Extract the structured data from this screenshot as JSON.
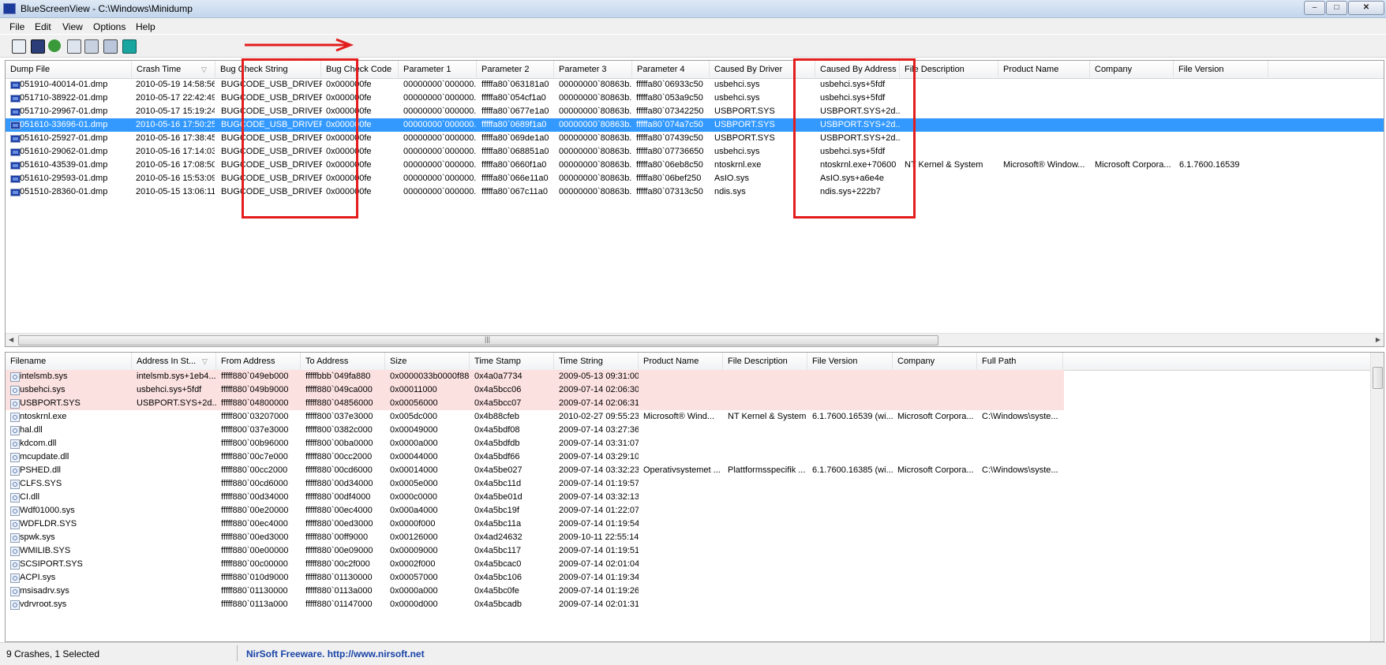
{
  "window": {
    "title": "BlueScreenView  -  C:\\Windows\\Minidump",
    "minimize": "–",
    "maximize": "□",
    "close": "✕"
  },
  "menu": [
    "File",
    "Edit",
    "View",
    "Options",
    "Help"
  ],
  "toolbar": [
    "save-html-report-icon",
    "save-icon",
    "refresh-icon",
    "copy-icon",
    "properties-icon",
    "advanced-options-icon",
    "exit-icon"
  ],
  "top_table": {
    "columns": [
      "Dump File",
      "Crash Time",
      "Bug Check String",
      "Bug Check Code",
      "Parameter 1",
      "Parameter 2",
      "Parameter 3",
      "Parameter 4",
      "Caused By Driver",
      "Caused By Address",
      "File Description",
      "Product Name",
      "Company",
      "File Version"
    ],
    "rows": [
      [
        "051910-40014-01.dmp",
        "2010-05-19 14:58:56",
        "BUGCODE_USB_DRIVER",
        "0x000000fe",
        "00000000`000000...",
        "fffffa80`063181a0",
        "00000000`80863b...",
        "fffffa80`06933c50",
        "usbehci.sys",
        "usbehci.sys+5fdf",
        "",
        "",
        "",
        ""
      ],
      [
        "051710-38922-01.dmp",
        "2010-05-17 22:42:49",
        "BUGCODE_USB_DRIVER",
        "0x000000fe",
        "00000000`000000...",
        "fffffa80`054cf1a0",
        "00000000`80863b...",
        "fffffa80`053a9c50",
        "usbehci.sys",
        "usbehci.sys+5fdf",
        "",
        "",
        "",
        ""
      ],
      [
        "051710-29967-01.dmp",
        "2010-05-17 15:19:24",
        "BUGCODE_USB_DRIVER",
        "0x000000fe",
        "00000000`000000...",
        "fffffa80`0677e1a0",
        "00000000`80863b...",
        "fffffa80`07342250",
        "USBPORT.SYS",
        "USBPORT.SYS+2d...",
        "",
        "",
        "",
        ""
      ],
      [
        "051610-33696-01.dmp",
        "2010-05-16 17:50:25",
        "BUGCODE_USB_DRIVER",
        "0x000000fe",
        "00000000`000000...",
        "fffffa80`0689f1a0",
        "00000000`80863b...",
        "fffffa80`074a7c50",
        "USBPORT.SYS",
        "USBPORT.SYS+2d...",
        "",
        "",
        "",
        ""
      ],
      [
        "051610-25927-01.dmp",
        "2010-05-16 17:38:45",
        "BUGCODE_USB_DRIVER",
        "0x000000fe",
        "00000000`000000...",
        "fffffa80`069de1a0",
        "00000000`80863b...",
        "fffffa80`07439c50",
        "USBPORT.SYS",
        "USBPORT.SYS+2d...",
        "",
        "",
        "",
        ""
      ],
      [
        "051610-29062-01.dmp",
        "2010-05-16 17:14:03",
        "BUGCODE_USB_DRIVER",
        "0x000000fe",
        "00000000`000000...",
        "fffffa80`068851a0",
        "00000000`80863b...",
        "fffffa80`07736650",
        "usbehci.sys",
        "usbehci.sys+5fdf",
        "",
        "",
        "",
        ""
      ],
      [
        "051610-43539-01.dmp",
        "2010-05-16 17:08:50",
        "BUGCODE_USB_DRIVER",
        "0x000000fe",
        "00000000`000000...",
        "fffffa80`0660f1a0",
        "00000000`80863b...",
        "fffffa80`06eb8c50",
        "ntoskrnl.exe",
        "ntoskrnl.exe+70600",
        "NT Kernel & System",
        "Microsoft® Window...",
        "Microsoft Corpora...",
        "6.1.7600.16539"
      ],
      [
        "051610-29593-01.dmp",
        "2010-05-16 15:53:09",
        "BUGCODE_USB_DRIVER",
        "0x000000fe",
        "00000000`000000...",
        "fffffa80`066e11a0",
        "00000000`80863b...",
        "fffffa80`06bef250",
        "AsIO.sys",
        "AsIO.sys+a6e4e",
        "",
        "",
        "",
        ""
      ],
      [
        "051510-28360-01.dmp",
        "2010-05-15 13:06:11",
        "BUGCODE_USB_DRIVER",
        "0x000000fe",
        "00000000`000000...",
        "fffffa80`067c11a0",
        "00000000`80863b...",
        "fffffa80`07313c50",
        "ndis.sys",
        "ndis.sys+222b7",
        "",
        "",
        "",
        ""
      ]
    ],
    "selected_index": 3,
    "scroll_grip": "|||",
    "scroll_left": "◀",
    "scroll_right": "▶"
  },
  "bottom_table": {
    "columns": [
      "Filename",
      "Address In St...",
      "From Address",
      "To Address",
      "Size",
      "Time Stamp",
      "Time String",
      "Product Name",
      "File Description",
      "File Version",
      "Company",
      "Full Path"
    ],
    "rows": [
      [
        "intelsmb.sys",
        "intelsmb.sys+1eb4...",
        "fffff880`049eb000",
        "fffffbbb`049fa880",
        "0x0000033b0000f880",
        "0x4a0a7734",
        "2009-05-13 09:31:00",
        "",
        "",
        "",
        "",
        ""
      ],
      [
        "usbehci.sys",
        "usbehci.sys+5fdf",
        "fffff880`049b9000",
        "fffff880`049ca000",
        "0x00011000",
        "0x4a5bcc06",
        "2009-07-14 02:06:30",
        "",
        "",
        "",
        "",
        ""
      ],
      [
        "USBPORT.SYS",
        "USBPORT.SYS+2d...",
        "fffff880`04800000",
        "fffff880`04856000",
        "0x00056000",
        "0x4a5bcc07",
        "2009-07-14 02:06:31",
        "",
        "",
        "",
        "",
        ""
      ],
      [
        "ntoskrnl.exe",
        "",
        "fffff800`03207000",
        "fffff800`037e3000",
        "0x005dc000",
        "0x4b88cfeb",
        "2010-02-27 09:55:23",
        "Microsoft® Wind...",
        "NT Kernel & System",
        "6.1.7600.16539 (wi...",
        "Microsoft Corpora...",
        "C:\\Windows\\syste..."
      ],
      [
        "hal.dll",
        "",
        "fffff800`037e3000",
        "fffff800`0382c000",
        "0x00049000",
        "0x4a5bdf08",
        "2009-07-14 03:27:36",
        "",
        "",
        "",
        "",
        ""
      ],
      [
        "kdcom.dll",
        "",
        "fffff800`00b96000",
        "fffff800`00ba0000",
        "0x0000a000",
        "0x4a5bdfdb",
        "2009-07-14 03:31:07",
        "",
        "",
        "",
        "",
        ""
      ],
      [
        "mcupdate.dll",
        "",
        "fffff880`00c7e000",
        "fffff880`00cc2000",
        "0x00044000",
        "0x4a5bdf66",
        "2009-07-14 03:29:10",
        "",
        "",
        "",
        "",
        ""
      ],
      [
        "PSHED.dll",
        "",
        "fffff880`00cc2000",
        "fffff880`00cd6000",
        "0x00014000",
        "0x4a5be027",
        "2009-07-14 03:32:23",
        "Operativsystemet ...",
        "Plattformsspecifik ...",
        "6.1.7600.16385 (wi...",
        "Microsoft Corpora...",
        "C:\\Windows\\syste..."
      ],
      [
        "CLFS.SYS",
        "",
        "fffff880`00cd6000",
        "fffff880`00d34000",
        "0x0005e000",
        "0x4a5bc11d",
        "2009-07-14 01:19:57",
        "",
        "",
        "",
        "",
        ""
      ],
      [
        "CI.dll",
        "",
        "fffff880`00d34000",
        "fffff880`00df4000",
        "0x000c0000",
        "0x4a5be01d",
        "2009-07-14 03:32:13",
        "",
        "",
        "",
        "",
        ""
      ],
      [
        "Wdf01000.sys",
        "",
        "fffff880`00e20000",
        "fffff880`00ec4000",
        "0x000a4000",
        "0x4a5bc19f",
        "2009-07-14 01:22:07",
        "",
        "",
        "",
        "",
        ""
      ],
      [
        "WDFLDR.SYS",
        "",
        "fffff880`00ec4000",
        "fffff880`00ed3000",
        "0x0000f000",
        "0x4a5bc11a",
        "2009-07-14 01:19:54",
        "",
        "",
        "",
        "",
        ""
      ],
      [
        "spwk.sys",
        "",
        "fffff880`00ed3000",
        "fffff880`00ff9000",
        "0x00126000",
        "0x4ad24632",
        "2009-10-11 22:55:14",
        "",
        "",
        "",
        "",
        ""
      ],
      [
        "WMILIB.SYS",
        "",
        "fffff880`00e00000",
        "fffff880`00e09000",
        "0x00009000",
        "0x4a5bc117",
        "2009-07-14 01:19:51",
        "",
        "",
        "",
        "",
        ""
      ],
      [
        "SCSIPORT.SYS",
        "",
        "fffff880`00c00000",
        "fffff880`00c2f000",
        "0x0002f000",
        "0x4a5bcac0",
        "2009-07-14 02:01:04",
        "",
        "",
        "",
        "",
        ""
      ],
      [
        "ACPI.sys",
        "",
        "fffff880`010d9000",
        "fffff880`01130000",
        "0x00057000",
        "0x4a5bc106",
        "2009-07-14 01:19:34",
        "",
        "",
        "",
        "",
        ""
      ],
      [
        "msisadrv.sys",
        "",
        "fffff880`01130000",
        "fffff880`0113a000",
        "0x0000a000",
        "0x4a5bc0fe",
        "2009-07-14 01:19:26",
        "",
        "",
        "",
        "",
        ""
      ],
      [
        "vdrvroot.sys",
        "",
        "fffff880`0113a000",
        "fffff880`01147000",
        "0x0000d000",
        "0x4a5bcadb",
        "2009-07-14 02:01:31",
        "",
        "",
        "",
        "",
        ""
      ]
    ],
    "highlighted_count": 3
  },
  "status": {
    "left": "9 Crashes, 1 Selected",
    "link": "NirSoft Freeware.  http://www.nirsoft.net"
  },
  "colors": {
    "selection": "#3399ff",
    "highlight_row": "#fce1e1",
    "annotation": "#e31c1c",
    "link": "#1a44a8"
  }
}
